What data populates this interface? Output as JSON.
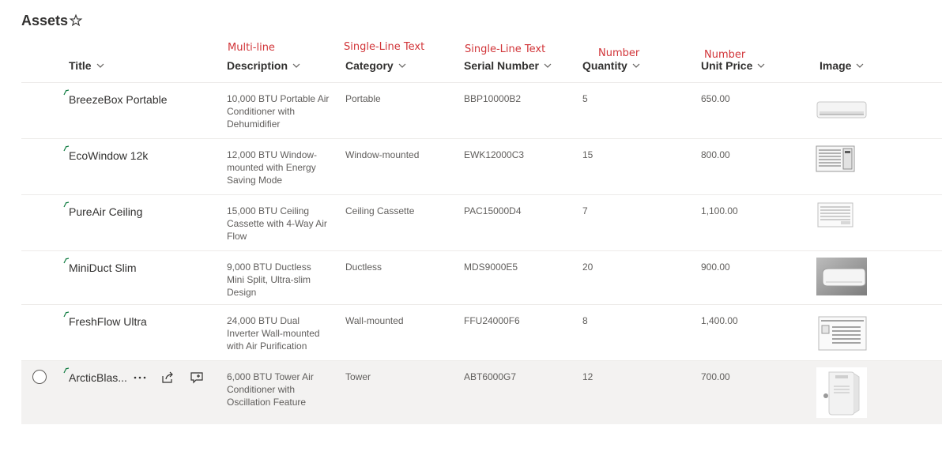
{
  "page": {
    "title": "Assets"
  },
  "annotations": {
    "description": "Multi-line",
    "category": "Single-Line Text",
    "serial": "Single-Line Text",
    "quantity": "Number",
    "unit_price": "Number"
  },
  "columns": {
    "title": "Title",
    "description": "Description",
    "category": "Category",
    "serial": "Serial Number",
    "quantity": "Quantity",
    "unit_price": "Unit Price",
    "image": "Image"
  },
  "rows": [
    {
      "title": "BreezeBox Portable",
      "description": "10,000 BTU Portable Air Conditioner with Dehumidifier",
      "category": "Portable",
      "serial": "BBP10000B2",
      "quantity": "5",
      "unit_price": "650.00",
      "image": "wall-split-unit-image"
    },
    {
      "title": "EcoWindow 12k",
      "description": "12,000 BTU Window-mounted with Energy Saving Mode",
      "category": "Window-mounted",
      "serial": "EWK12000C3",
      "quantity": "15",
      "unit_price": "800.00",
      "image": "window-unit-image"
    },
    {
      "title": "PureAir Ceiling",
      "description": "15,000 BTU Ceiling Cassette with 4-Way Air Flow",
      "category": "Ceiling Cassette",
      "serial": "PAC15000D4",
      "quantity": "7",
      "unit_price": "1,100.00",
      "image": "window-unit-image"
    },
    {
      "title": "MiniDuct Slim",
      "description": "9,000 BTU Ductless Mini Split, Ultra-slim Design",
      "category": "Ductless",
      "serial": "MDS9000E5",
      "quantity": "20",
      "unit_price": "900.00",
      "image": "mini-split-photo"
    },
    {
      "title": "FreshFlow Ultra",
      "description": "24,000 BTU Dual Inverter Wall-mounted with Air Purification",
      "category": "Wall-mounted",
      "serial": "FFU24000F6",
      "quantity": "8",
      "unit_price": "1,400.00",
      "image": "window-unit-image"
    },
    {
      "title": "ArcticBlas...",
      "description": "6,000 BTU Tower Air Conditioner with Oscillation Feature",
      "category": "Tower",
      "serial": "ABT6000G7",
      "quantity": "12",
      "unit_price": "700.00",
      "image": "portable-tower-image"
    }
  ],
  "colors": {
    "accent_new": "#107c41",
    "annotation": "#d13438",
    "selected_row": "#f3f2f1"
  }
}
